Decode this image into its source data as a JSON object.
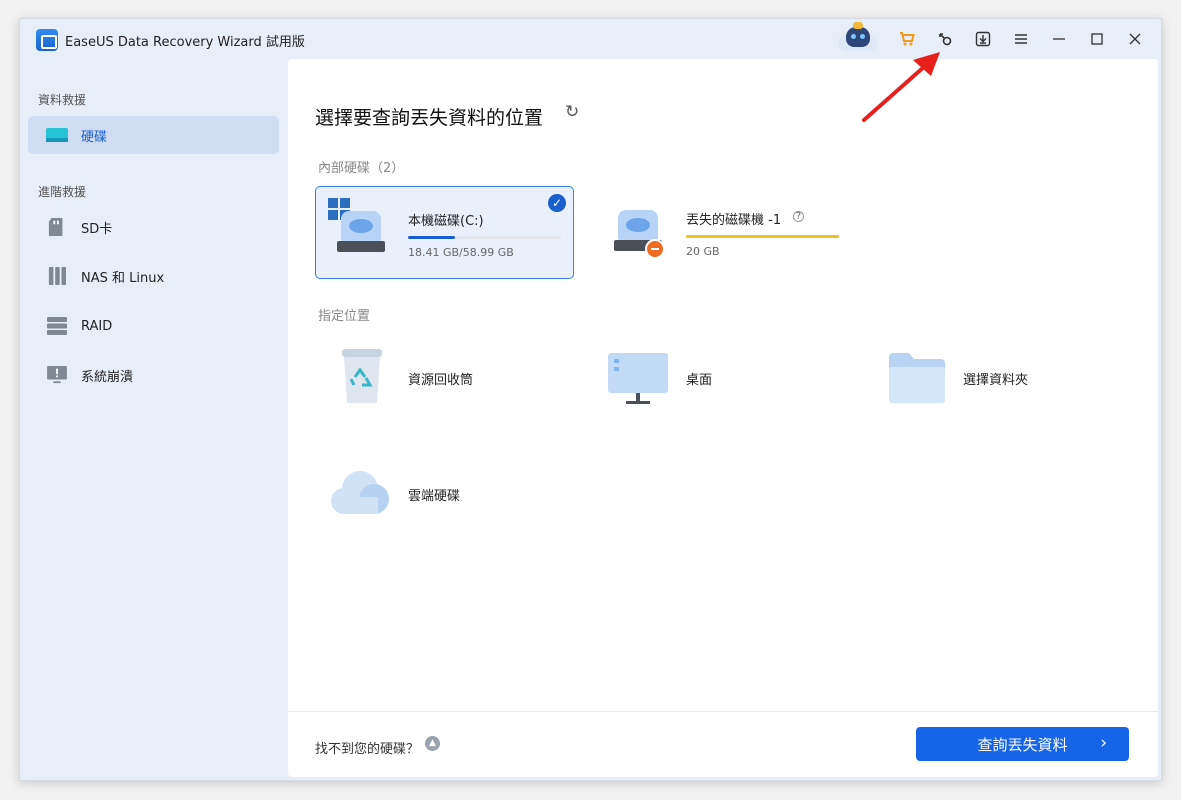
{
  "app": {
    "title": "EaseUS Data Recovery Wizard 試用版"
  },
  "titlebar": {
    "icons": [
      "robot-assistant-icon",
      "cart-icon",
      "key-icon",
      "download-icon",
      "menu-icon",
      "minimize-icon",
      "maximize-icon",
      "close-icon"
    ]
  },
  "sidebar": {
    "section1": "資料救援",
    "section2": "進階救援",
    "items": [
      {
        "label": "硬碟",
        "icon": "hard-drive-icon",
        "active": true
      },
      {
        "label": "SD卡",
        "icon": "sd-card-icon"
      },
      {
        "label": "NAS 和 Linux",
        "icon": "nas-icon"
      },
      {
        "label": "RAID",
        "icon": "raid-icon"
      },
      {
        "label": "系統崩潰",
        "icon": "system-crash-icon"
      }
    ]
  },
  "main": {
    "title": "選擇要查詢丟失資料的位置",
    "internal_label": "內部硬碟（2）",
    "drives": [
      {
        "name": "本機磁碟(C:)",
        "size": "18.41 GB/58.99 GB",
        "usage": 0.31,
        "bar_color": "#1a5fce",
        "selected": true
      },
      {
        "name": "丟失的磁碟機 -1",
        "size": "20 GB",
        "usage": 1.0,
        "bar_color": "#f0c020",
        "selected": false
      }
    ],
    "location_label": "指定位置",
    "locations": [
      {
        "label": "資源回收筒",
        "icon": "recycle-bin-icon"
      },
      {
        "label": "桌面",
        "icon": "desktop-icon"
      },
      {
        "label": "選擇資料夾",
        "icon": "folder-icon"
      },
      {
        "label": "雲端硬碟",
        "icon": "cloud-icon"
      }
    ],
    "footer_text": "找不到您的硬碟？",
    "scan_button": "查詢丟失資料"
  },
  "colors": {
    "accent": "#1565e6",
    "annotation_arrow": "#e8201c"
  }
}
